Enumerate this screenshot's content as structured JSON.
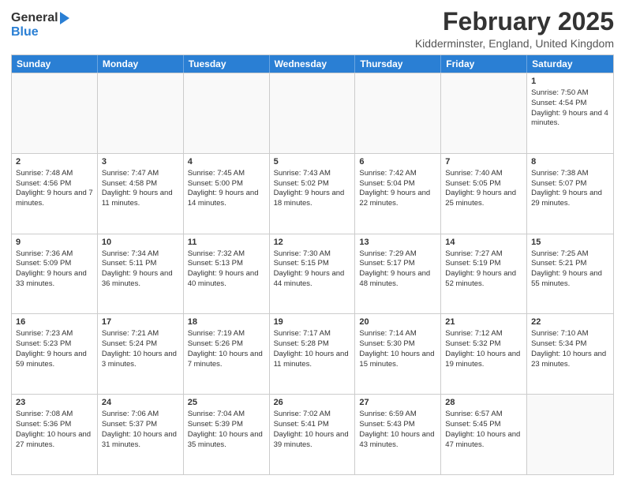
{
  "logo": {
    "general": "General",
    "blue": "Blue"
  },
  "title": "February 2025",
  "location": "Kidderminster, England, United Kingdom",
  "days": [
    "Sunday",
    "Monday",
    "Tuesday",
    "Wednesday",
    "Thursday",
    "Friday",
    "Saturday"
  ],
  "weeks": [
    [
      {
        "day": "",
        "info": ""
      },
      {
        "day": "",
        "info": ""
      },
      {
        "day": "",
        "info": ""
      },
      {
        "day": "",
        "info": ""
      },
      {
        "day": "",
        "info": ""
      },
      {
        "day": "",
        "info": ""
      },
      {
        "day": "1",
        "info": "Sunrise: 7:50 AM\nSunset: 4:54 PM\nDaylight: 9 hours and 4 minutes."
      }
    ],
    [
      {
        "day": "2",
        "info": "Sunrise: 7:48 AM\nSunset: 4:56 PM\nDaylight: 9 hours and 7 minutes."
      },
      {
        "day": "3",
        "info": "Sunrise: 7:47 AM\nSunset: 4:58 PM\nDaylight: 9 hours and 11 minutes."
      },
      {
        "day": "4",
        "info": "Sunrise: 7:45 AM\nSunset: 5:00 PM\nDaylight: 9 hours and 14 minutes."
      },
      {
        "day": "5",
        "info": "Sunrise: 7:43 AM\nSunset: 5:02 PM\nDaylight: 9 hours and 18 minutes."
      },
      {
        "day": "6",
        "info": "Sunrise: 7:42 AM\nSunset: 5:04 PM\nDaylight: 9 hours and 22 minutes."
      },
      {
        "day": "7",
        "info": "Sunrise: 7:40 AM\nSunset: 5:05 PM\nDaylight: 9 hours and 25 minutes."
      },
      {
        "day": "8",
        "info": "Sunrise: 7:38 AM\nSunset: 5:07 PM\nDaylight: 9 hours and 29 minutes."
      }
    ],
    [
      {
        "day": "9",
        "info": "Sunrise: 7:36 AM\nSunset: 5:09 PM\nDaylight: 9 hours and 33 minutes."
      },
      {
        "day": "10",
        "info": "Sunrise: 7:34 AM\nSunset: 5:11 PM\nDaylight: 9 hours and 36 minutes."
      },
      {
        "day": "11",
        "info": "Sunrise: 7:32 AM\nSunset: 5:13 PM\nDaylight: 9 hours and 40 minutes."
      },
      {
        "day": "12",
        "info": "Sunrise: 7:30 AM\nSunset: 5:15 PM\nDaylight: 9 hours and 44 minutes."
      },
      {
        "day": "13",
        "info": "Sunrise: 7:29 AM\nSunset: 5:17 PM\nDaylight: 9 hours and 48 minutes."
      },
      {
        "day": "14",
        "info": "Sunrise: 7:27 AM\nSunset: 5:19 PM\nDaylight: 9 hours and 52 minutes."
      },
      {
        "day": "15",
        "info": "Sunrise: 7:25 AM\nSunset: 5:21 PM\nDaylight: 9 hours and 55 minutes."
      }
    ],
    [
      {
        "day": "16",
        "info": "Sunrise: 7:23 AM\nSunset: 5:23 PM\nDaylight: 9 hours and 59 minutes."
      },
      {
        "day": "17",
        "info": "Sunrise: 7:21 AM\nSunset: 5:24 PM\nDaylight: 10 hours and 3 minutes."
      },
      {
        "day": "18",
        "info": "Sunrise: 7:19 AM\nSunset: 5:26 PM\nDaylight: 10 hours and 7 minutes."
      },
      {
        "day": "19",
        "info": "Sunrise: 7:17 AM\nSunset: 5:28 PM\nDaylight: 10 hours and 11 minutes."
      },
      {
        "day": "20",
        "info": "Sunrise: 7:14 AM\nSunset: 5:30 PM\nDaylight: 10 hours and 15 minutes."
      },
      {
        "day": "21",
        "info": "Sunrise: 7:12 AM\nSunset: 5:32 PM\nDaylight: 10 hours and 19 minutes."
      },
      {
        "day": "22",
        "info": "Sunrise: 7:10 AM\nSunset: 5:34 PM\nDaylight: 10 hours and 23 minutes."
      }
    ],
    [
      {
        "day": "23",
        "info": "Sunrise: 7:08 AM\nSunset: 5:36 PM\nDaylight: 10 hours and 27 minutes."
      },
      {
        "day": "24",
        "info": "Sunrise: 7:06 AM\nSunset: 5:37 PM\nDaylight: 10 hours and 31 minutes."
      },
      {
        "day": "25",
        "info": "Sunrise: 7:04 AM\nSunset: 5:39 PM\nDaylight: 10 hours and 35 minutes."
      },
      {
        "day": "26",
        "info": "Sunrise: 7:02 AM\nSunset: 5:41 PM\nDaylight: 10 hours and 39 minutes."
      },
      {
        "day": "27",
        "info": "Sunrise: 6:59 AM\nSunset: 5:43 PM\nDaylight: 10 hours and 43 minutes."
      },
      {
        "day": "28",
        "info": "Sunrise: 6:57 AM\nSunset: 5:45 PM\nDaylight: 10 hours and 47 minutes."
      },
      {
        "day": "",
        "info": ""
      }
    ]
  ]
}
